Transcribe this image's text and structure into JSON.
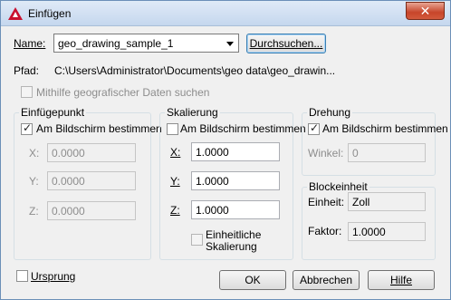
{
  "window": {
    "title": "Einfügen",
    "close_symbol": "✕"
  },
  "name": {
    "label": "Name:",
    "value": "geo_drawing_sample_1",
    "browse_button": "Durchsuchen..."
  },
  "path": {
    "label": "Pfad:",
    "value": "C:\\Users\\Administrator\\Documents\\geo data\\geo_drawin..."
  },
  "geo_option": {
    "label": "Mithilfe geografischer Daten suchen"
  },
  "insertion_point": {
    "title": "Einfügepunkt",
    "on_screen_label": "Am Bildschirm bestimmen",
    "x_label": "X:",
    "x_value": "0.0000",
    "y_label": "Y:",
    "y_value": "0.0000",
    "z_label": "Z:",
    "z_value": "0.0000"
  },
  "scale": {
    "title": "Skalierung",
    "on_screen_label": "Am Bildschirm bestimmen",
    "x_label": "X:",
    "x_value": "1.0000",
    "y_label": "Y:",
    "y_value": "1.0000",
    "z_label": "Z:",
    "z_value": "1.0000",
    "uniform_line1": "Einheitliche",
    "uniform_line2": "Skalierung"
  },
  "rotation": {
    "title": "Drehung",
    "on_screen_label": "Am Bildschirm bestimmen",
    "angle_label": "Winkel:",
    "angle_value": "0"
  },
  "block_unit": {
    "title": "Blockeinheit",
    "unit_label": "Einheit:",
    "unit_value": "Zoll",
    "factor_label": "Faktor:",
    "factor_value": "1.0000"
  },
  "explode": {
    "label": "Ursprung"
  },
  "buttons": {
    "ok": "OK",
    "cancel": "Abbrechen",
    "help": "Hilfe"
  }
}
